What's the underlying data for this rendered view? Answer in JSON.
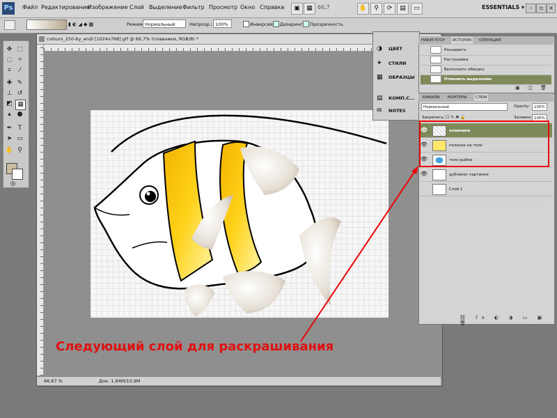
{
  "menubar": {
    "items": [
      "Файл",
      "Редактирование",
      "Изображение",
      "Слой",
      "Выделение",
      "Фильтр",
      "Просмотр",
      "Окно",
      "Справка"
    ],
    "zoom": "66,7",
    "workspace": "ESSENTIALS ▾"
  },
  "options": {
    "mode_label": "Режим:",
    "mode_value": "Нормальный",
    "opacity_label": "Непрозр.:",
    "opacity_value": "100%",
    "inverse_label": "Инверсия",
    "dither_label": "Дизеринг",
    "transparency_label": "Прозрачность"
  },
  "document": {
    "title": "colours_250-by_endi [1024x768].gif @ 66,7% (плавники, RGB/8) *",
    "status_zoom": "66,67 %",
    "status_doc": "Док: 1,94М/10,9М"
  },
  "collapsed_panels": [
    "ЦВЕТ",
    "СТИЛИ",
    "ОБРАЗЦЫ",
    "КОМП.С...",
    "NOTES"
  ],
  "history": {
    "tabs": [
      "НАВИГАТОР",
      "ИСТОРИЯ",
      "ОПЕРАЦИИ"
    ],
    "active_tab": "ИСТОРИЯ",
    "items": [
      "Расширить",
      "Растушевка",
      "Выполнить обводку",
      "Отменить выделение"
    ],
    "selected_index": 3
  },
  "layers": {
    "tabs": [
      "КАНАЛЫ",
      "КОНТУРЫ",
      "СЛОИ"
    ],
    "active_tab": "СЛОИ",
    "blend_mode": "Нормальный",
    "opacity_label": "Opacity:",
    "opacity_value": "100%",
    "lock_label": "Закрепить:",
    "fill_label": "Заливка:",
    "fill_value": "100%",
    "items": [
      {
        "name": "плавники",
        "visible": true,
        "selected": true
      },
      {
        "name": "полоски на теле",
        "visible": true,
        "selected": false
      },
      {
        "name": "тело рыбки",
        "visible": true,
        "selected": false
      },
      {
        "name": "дубликат картинки",
        "visible": true,
        "selected": false
      },
      {
        "name": "Слой 1",
        "visible": false,
        "selected": false
      }
    ]
  },
  "annotation": {
    "text": "Следующий  слой для раскрашивания",
    "color": "#e01010"
  },
  "colors": {
    "highlight": "#7f8a5a",
    "stripe_yellow": "#f5c400",
    "fin_gray": "#c8c0b4"
  },
  "icons": {
    "fg_bg_swatch": "color-swatch-icon",
    "eye": "eye-icon"
  }
}
